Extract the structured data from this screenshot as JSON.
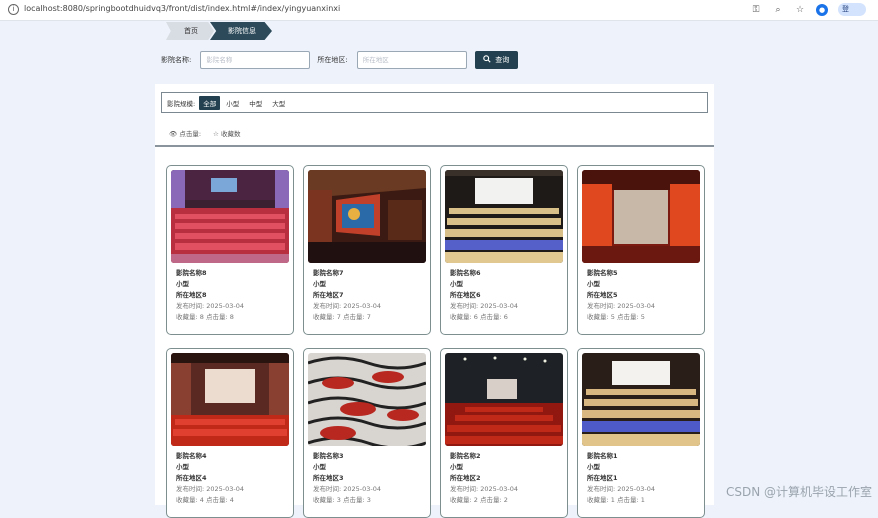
{
  "browser": {
    "url": "localhost:8080/springbootdhuidvq3/front/dist/index.html#/index/yingyuanxinxi",
    "profile_label": "登"
  },
  "breadcrumb": {
    "home": "首页",
    "current": "影院信息"
  },
  "search": {
    "name_label": "影院名称:",
    "name_placeholder": "影院名称",
    "region_label": "所在地区:",
    "region_placeholder": "所在地区",
    "button_label": "查询"
  },
  "filter": {
    "label": "影院规模:",
    "options": [
      "全部",
      "小型",
      "中型",
      "大型"
    ],
    "selected": "全部"
  },
  "sort": {
    "clicks": "点击量:",
    "favorites": "收藏数"
  },
  "cards": [
    {
      "name": "影院名称8",
      "size": "小型",
      "region": "所在地区8",
      "date": "发布时间: 2025-03-04",
      "stats": "收藏量: 8  点击量: 8"
    },
    {
      "name": "影院名称7",
      "size": "小型",
      "region": "所在地区7",
      "date": "发布时间: 2025-03-04",
      "stats": "收藏量: 7  点击量: 7"
    },
    {
      "name": "影院名称6",
      "size": "小型",
      "region": "所在地区6",
      "date": "发布时间: 2025-03-04",
      "stats": "收藏量: 6  点击量: 6"
    },
    {
      "name": "影院名称5",
      "size": "小型",
      "region": "所在地区5",
      "date": "发布时间: 2025-03-04",
      "stats": "收藏量: 5  点击量: 5"
    },
    {
      "name": "影院名称4",
      "size": "小型",
      "region": "所在地区4",
      "date": "发布时间: 2025-03-04",
      "stats": "收藏量: 4  点击量: 4"
    },
    {
      "name": "影院名称3",
      "size": "小型",
      "region": "所在地区3",
      "date": "发布时间: 2025-03-04",
      "stats": "收藏量: 3  点击量: 3"
    },
    {
      "name": "影院名称2",
      "size": "小型",
      "region": "所在地区2",
      "date": "发布时间: 2025-03-04",
      "stats": "收藏量: 2  点击量: 2"
    },
    {
      "name": "影院名称1",
      "size": "小型",
      "region": "所在地区1",
      "date": "发布时间: 2025-03-04",
      "stats": "收藏量: 1  点击量: 1"
    }
  ],
  "watermark": "CSDN @计算机毕设工作室",
  "colors": {
    "accent": "#22404f",
    "page_bg": "#eef3fb",
    "card_border": "#7d8f8f"
  }
}
